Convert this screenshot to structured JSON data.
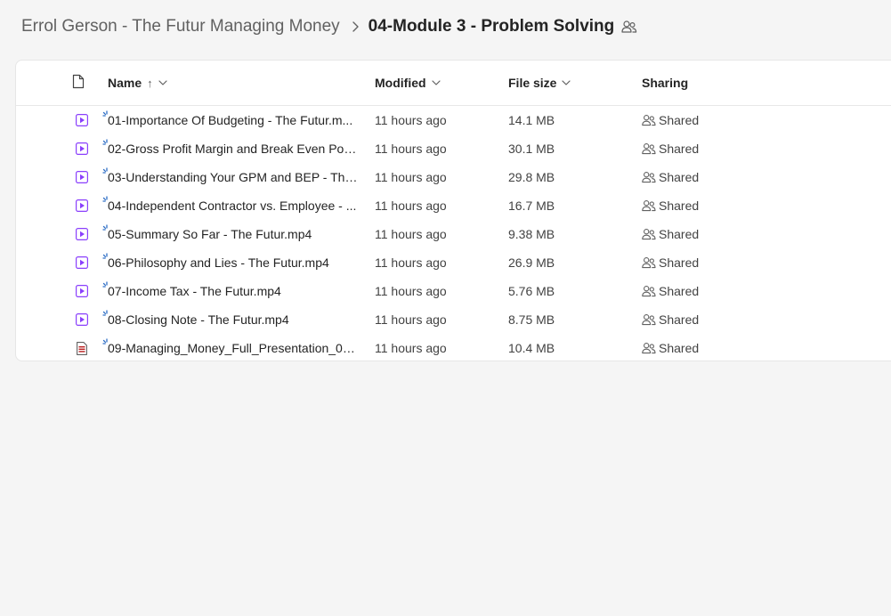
{
  "breadcrumb": {
    "parent": "Errol Gerson - The Futur Managing Money",
    "current": "04-Module 3 - Problem Solving"
  },
  "columns": {
    "name": "Name",
    "name_sort": "↑",
    "modified": "Modified",
    "file_size": "File size",
    "sharing": "Sharing"
  },
  "files": [
    {
      "icon": "video-file-icon",
      "name": "01-Importance Of Budgeting - The Futur.m...",
      "modified": "11 hours ago",
      "size": "14.1 MB",
      "sharing": "Shared"
    },
    {
      "icon": "video-file-icon",
      "name": "02-Gross Profit Margin and Break Even Poin...",
      "modified": "11 hours ago",
      "size": "30.1 MB",
      "sharing": "Shared"
    },
    {
      "icon": "video-file-icon",
      "name": "03-Understanding Your GPM and BEP - The...",
      "modified": "11 hours ago",
      "size": "29.8 MB",
      "sharing": "Shared"
    },
    {
      "icon": "video-file-icon",
      "name": "04-Independent Contractor vs. Employee - ...",
      "modified": "11 hours ago",
      "size": "16.7 MB",
      "sharing": "Shared"
    },
    {
      "icon": "video-file-icon",
      "name": "05-Summary So Far - The Futur.mp4",
      "modified": "11 hours ago",
      "size": "9.38 MB",
      "sharing": "Shared"
    },
    {
      "icon": "video-file-icon",
      "name": "06-Philosophy and Lies - The Futur.mp4",
      "modified": "11 hours ago",
      "size": "26.9 MB",
      "sharing": "Shared"
    },
    {
      "icon": "video-file-icon",
      "name": "07-Income Tax - The Futur.mp4",
      "modified": "11 hours ago",
      "size": "5.76 MB",
      "sharing": "Shared"
    },
    {
      "icon": "video-file-icon",
      "name": "08-Closing Note - The Futur.mp4",
      "modified": "11 hours ago",
      "size": "8.75 MB",
      "sharing": "Shared"
    },
    {
      "icon": "pdf-file-icon",
      "name": "09-Managing_Money_Full_Presentation_06_...",
      "modified": "11 hours ago",
      "size": "10.4 MB",
      "sharing": "Shared"
    }
  ],
  "colors": {
    "video_icon": "#8a3ffc",
    "pdf_icon": "#b91c1c",
    "new_marker": "#2f6fc6"
  }
}
